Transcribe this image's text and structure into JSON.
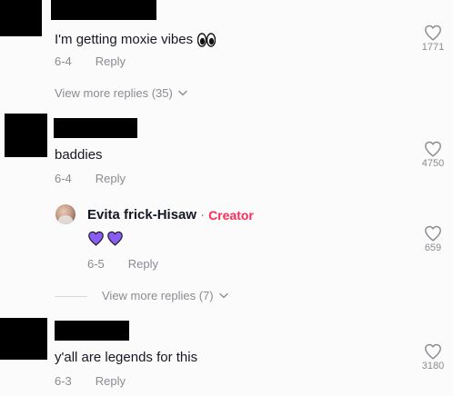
{
  "comments": [
    {
      "text": "I'm getting moxie vibes",
      "emoji": "eyes",
      "date": "6-4",
      "reply_label": "Reply",
      "likes": "1771",
      "view_more": "View more replies (35)"
    },
    {
      "text": "baddies",
      "date": "6-4",
      "reply_label": "Reply",
      "likes": "4750",
      "view_more": "View more replies (7)"
    },
    {
      "text": "y'all are legends for this",
      "date": "6-3",
      "reply_label": "Reply",
      "likes": "3180"
    }
  ],
  "reply": {
    "author": "Evita frick-Hisaw",
    "separator": "·",
    "badge": "Creator",
    "content_emoji": "purple-hearts",
    "date": "6-5",
    "reply_label": "Reply",
    "likes": "659"
  },
  "colors": {
    "background": "#fbfbfb",
    "text": "#161823",
    "muted": "#8a8b91",
    "creator": "#fe2c55",
    "heart_emoji": "#8a5cf6"
  },
  "icons": {
    "like": "heart-outline-icon",
    "expand": "chevron-down-icon",
    "emoji_eyes": "eyes-emoji",
    "emoji_hearts": "purple-heart-emoji"
  }
}
